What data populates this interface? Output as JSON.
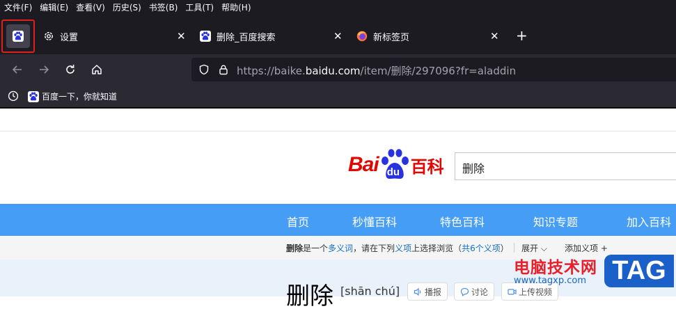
{
  "menubar": {
    "items": [
      "文件(F)",
      "编辑(E)",
      "查看(V)",
      "历史(S)",
      "书签(B)",
      "工具(T)",
      "帮助(H)"
    ]
  },
  "tabs": [
    {
      "label": "设置",
      "icon": "gear-icon"
    },
    {
      "label": "删除_百度搜索",
      "icon": "baidu-paw-icon"
    },
    {
      "label": "新标签页",
      "icon": "firefox-icon"
    }
  ],
  "pinned_tab": {
    "icon": "baidu-paw-icon",
    "highlight_color": "#e0201b"
  },
  "urlbar": {
    "prefix": "https://baike.",
    "domain": "baidu.com",
    "path": "/item/删除/297096?fr=aladdin"
  },
  "bookmarks": {
    "item": "百度一下，你就知道"
  },
  "page": {
    "logo_text": "Bai",
    "logo_paw_text": "du",
    "logo_suffix": "百科",
    "search_value": "删除",
    "nav": [
      "首页",
      "秒懂百科",
      "特色百科",
      "知识专题",
      "加入百科"
    ],
    "polysemy": {
      "term": "删除",
      "mid1": "是一个",
      "link1": "多义词",
      "mid2": "，请在下列",
      "link2": "义项",
      "mid3": "上选择浏览（",
      "link3": "共6个义项",
      "end": "）",
      "expand": "展开",
      "add": "添加义项"
    },
    "title": "删除",
    "pinyin": "[shān chú]",
    "actions": [
      {
        "label": "播报",
        "icon": "speaker-icon"
      },
      {
        "label": "讨论",
        "icon": "chat-icon"
      },
      {
        "label": "上传视频",
        "icon": "video-icon"
      }
    ]
  },
  "watermark": {
    "line1": "电脑技术网",
    "line2": "www.tagxp.com",
    "tag": "TAG"
  },
  "colors": {
    "chrome_dark": "#1c1b22",
    "toolbar": "#2b2a33",
    "baidu_red": "#e10602",
    "baidu_blue": "#2932e1",
    "nav_blue": "#459df5"
  }
}
